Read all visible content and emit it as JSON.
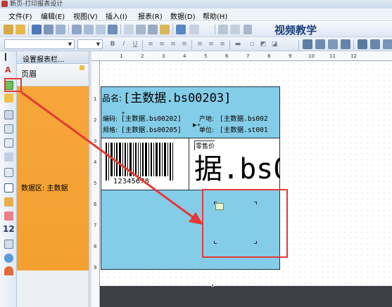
{
  "window": {
    "title": "新页-打印报表设计"
  },
  "menu": [
    {
      "label": "文件(F)"
    },
    {
      "label": "编辑(E)"
    },
    {
      "label": "视图(V)"
    },
    {
      "label": "插入(I)"
    },
    {
      "label": "报表(R)"
    },
    {
      "label": "数据(D)"
    },
    {
      "label": "帮助(H)"
    }
  ],
  "watermark": "视频教学",
  "tools": {
    "text_letter": "A",
    "number_label": "12"
  },
  "band_panel": {
    "header_label": "设置报表栏...",
    "page_band": "页眉",
    "data_band": "数据区: 主数据"
  },
  "ruler": {
    "top_numbers": [
      "1",
      "2",
      "3",
      "4",
      "5",
      "6",
      "7",
      "8",
      "9",
      "10",
      "11",
      "12"
    ],
    "left_numbers": [
      "1",
      "2",
      "3",
      "4",
      "5",
      "6",
      "7",
      "8",
      "9"
    ]
  },
  "report": {
    "product_name_label": "品名:",
    "product_name_value": "[主数据.bs00203]",
    "code_label": "编码:",
    "code_value": "[主数据.bs00202]",
    "origin_label": "产地:",
    "origin_value": "[主数据.bs002",
    "spec_label": "规格:",
    "spec_value": "[主数据.bs00205]",
    "unit_label": "单位:",
    "unit_value": "[主数据.st001",
    "barcode_number": "12345678",
    "price_label": "零售价",
    "price_value": "据.bs0"
  },
  "colors": {
    "band_blue": "#84cde8",
    "data_band_orange": "#f4a030",
    "annotation_red": "#e53935"
  }
}
